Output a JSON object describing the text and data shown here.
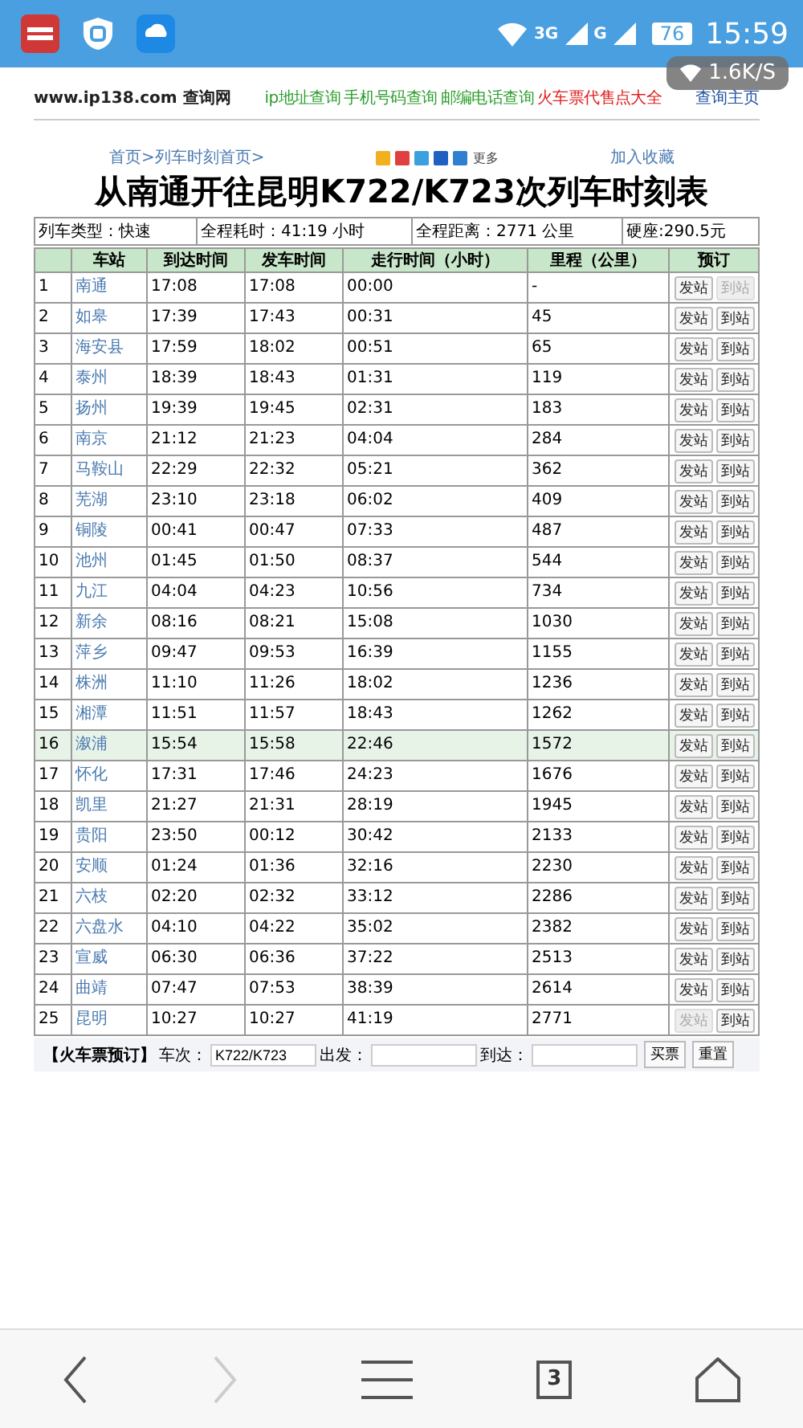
{
  "status_bar": {
    "network_3g": "3G",
    "network_g": "G",
    "battery": "76",
    "time": "15:59",
    "speed": "1.6K/S"
  },
  "header": {
    "site": "www.ip138.com 查询网",
    "links": [
      {
        "label": "ip地址查询",
        "color": "#2e9e2e"
      },
      {
        "label": "手机号码查询",
        "color": "#2e9e2e"
      },
      {
        "label": "邮编电话查询",
        "color": "#2e9e2e"
      },
      {
        "label": "火车票代售点大全",
        "color": "#e02020"
      }
    ],
    "home": "查询主页"
  },
  "breadcrumb": "首页>列车时刻首页>",
  "share_more": "更多",
  "bookmark": "加入收藏",
  "title": "从南通开往昆明K722/K723次列车时刻表",
  "info": [
    "列车类型：快速",
    "全程耗时：41:19 小时",
    "全程距离：2771 公里",
    "硬座:290.5元"
  ],
  "table": {
    "columns": [
      "",
      "车站",
      "到达时间",
      "发车时间",
      "走行时间（小时）",
      "里程（公里）",
      "预订"
    ],
    "rows": [
      {
        "no": "1",
        "station": "南通",
        "arrive": "17:08",
        "depart": "17:08",
        "elapsed": "00:00",
        "km": "-",
        "selected": false,
        "buttons": [
          {
            "label": "发站",
            "disabled": false
          },
          {
            "label": "到站",
            "disabled": true
          }
        ]
      },
      {
        "no": "2",
        "station": "如皋",
        "arrive": "17:39",
        "depart": "17:43",
        "elapsed": "00:31",
        "km": "45",
        "selected": false,
        "buttons": [
          {
            "label": "发站",
            "disabled": false
          },
          {
            "label": "到站",
            "disabled": false
          }
        ]
      },
      {
        "no": "3",
        "station": "海安县",
        "arrive": "17:59",
        "depart": "18:02",
        "elapsed": "00:51",
        "km": "65",
        "selected": false,
        "buttons": [
          {
            "label": "发站",
            "disabled": false
          },
          {
            "label": "到站",
            "disabled": false
          }
        ]
      },
      {
        "no": "4",
        "station": "泰州",
        "arrive": "18:39",
        "depart": "18:43",
        "elapsed": "01:31",
        "km": "119",
        "selected": false,
        "buttons": [
          {
            "label": "发站",
            "disabled": false
          },
          {
            "label": "到站",
            "disabled": false
          }
        ]
      },
      {
        "no": "5",
        "station": "扬州",
        "arrive": "19:39",
        "depart": "19:45",
        "elapsed": "02:31",
        "km": "183",
        "selected": false,
        "buttons": [
          {
            "label": "发站",
            "disabled": false
          },
          {
            "label": "到站",
            "disabled": false
          }
        ]
      },
      {
        "no": "6",
        "station": "南京",
        "arrive": "21:12",
        "depart": "21:23",
        "elapsed": "04:04",
        "km": "284",
        "selected": false,
        "buttons": [
          {
            "label": "发站",
            "disabled": false
          },
          {
            "label": "到站",
            "disabled": false
          }
        ]
      },
      {
        "no": "7",
        "station": "马鞍山",
        "arrive": "22:29",
        "depart": "22:32",
        "elapsed": "05:21",
        "km": "362",
        "selected": false,
        "buttons": [
          {
            "label": "发站",
            "disabled": false
          },
          {
            "label": "到站",
            "disabled": false
          }
        ]
      },
      {
        "no": "8",
        "station": "芜湖",
        "arrive": "23:10",
        "depart": "23:18",
        "elapsed": "06:02",
        "km": "409",
        "selected": false,
        "buttons": [
          {
            "label": "发站",
            "disabled": false
          },
          {
            "label": "到站",
            "disabled": false
          }
        ]
      },
      {
        "no": "9",
        "station": "铜陵",
        "arrive": "00:41",
        "depart": "00:47",
        "elapsed": "07:33",
        "km": "487",
        "selected": false,
        "buttons": [
          {
            "label": "发站",
            "disabled": false
          },
          {
            "label": "到站",
            "disabled": false
          }
        ]
      },
      {
        "no": "10",
        "station": "池州",
        "arrive": "01:45",
        "depart": "01:50",
        "elapsed": "08:37",
        "km": "544",
        "selected": false,
        "buttons": [
          {
            "label": "发站",
            "disabled": false
          },
          {
            "label": "到站",
            "disabled": false
          }
        ]
      },
      {
        "no": "11",
        "station": "九江",
        "arrive": "04:04",
        "depart": "04:23",
        "elapsed": "10:56",
        "km": "734",
        "selected": false,
        "buttons": [
          {
            "label": "发站",
            "disabled": false
          },
          {
            "label": "到站",
            "disabled": false
          }
        ]
      },
      {
        "no": "12",
        "station": "新余",
        "arrive": "08:16",
        "depart": "08:21",
        "elapsed": "15:08",
        "km": "1030",
        "selected": false,
        "buttons": [
          {
            "label": "发站",
            "disabled": false
          },
          {
            "label": "到站",
            "disabled": false
          }
        ]
      },
      {
        "no": "13",
        "station": "萍乡",
        "arrive": "09:47",
        "depart": "09:53",
        "elapsed": "16:39",
        "km": "1155",
        "selected": false,
        "buttons": [
          {
            "label": "发站",
            "disabled": false
          },
          {
            "label": "到站",
            "disabled": false
          }
        ]
      },
      {
        "no": "14",
        "station": "株洲",
        "arrive": "11:10",
        "depart": "11:26",
        "elapsed": "18:02",
        "km": "1236",
        "selected": false,
        "buttons": [
          {
            "label": "发站",
            "disabled": false
          },
          {
            "label": "到站",
            "disabled": false
          }
        ]
      },
      {
        "no": "15",
        "station": "湘潭",
        "arrive": "11:51",
        "depart": "11:57",
        "elapsed": "18:43",
        "km": "1262",
        "selected": false,
        "buttons": [
          {
            "label": "发站",
            "disabled": false
          },
          {
            "label": "到站",
            "disabled": false
          }
        ]
      },
      {
        "no": "16",
        "station": "溆浦",
        "arrive": "15:54",
        "depart": "15:58",
        "elapsed": "22:46",
        "km": "1572",
        "selected": true,
        "buttons": [
          {
            "label": "发站",
            "disabled": false
          },
          {
            "label": "到站",
            "disabled": false
          }
        ]
      },
      {
        "no": "17",
        "station": "怀化",
        "arrive": "17:31",
        "depart": "17:46",
        "elapsed": "24:23",
        "km": "1676",
        "selected": false,
        "buttons": [
          {
            "label": "发站",
            "disabled": false
          },
          {
            "label": "到站",
            "disabled": false
          }
        ]
      },
      {
        "no": "18",
        "station": "凯里",
        "arrive": "21:27",
        "depart": "21:31",
        "elapsed": "28:19",
        "km": "1945",
        "selected": false,
        "buttons": [
          {
            "label": "发站",
            "disabled": false
          },
          {
            "label": "到站",
            "disabled": false
          }
        ]
      },
      {
        "no": "19",
        "station": "贵阳",
        "arrive": "23:50",
        "depart": "00:12",
        "elapsed": "30:42",
        "km": "2133",
        "selected": false,
        "buttons": [
          {
            "label": "发站",
            "disabled": false
          },
          {
            "label": "到站",
            "disabled": false
          }
        ]
      },
      {
        "no": "20",
        "station": "安顺",
        "arrive": "01:24",
        "depart": "01:36",
        "elapsed": "32:16",
        "km": "2230",
        "selected": false,
        "buttons": [
          {
            "label": "发站",
            "disabled": false
          },
          {
            "label": "到站",
            "disabled": false
          }
        ]
      },
      {
        "no": "21",
        "station": "六枝",
        "arrive": "02:20",
        "depart": "02:32",
        "elapsed": "33:12",
        "km": "2286",
        "selected": false,
        "buttons": [
          {
            "label": "发站",
            "disabled": false
          },
          {
            "label": "到站",
            "disabled": false
          }
        ]
      },
      {
        "no": "22",
        "station": "六盘水",
        "arrive": "04:10",
        "depart": "04:22",
        "elapsed": "35:02",
        "km": "2382",
        "selected": false,
        "buttons": [
          {
            "label": "发站",
            "disabled": false
          },
          {
            "label": "到站",
            "disabled": false
          }
        ]
      },
      {
        "no": "23",
        "station": "宣威",
        "arrive": "06:30",
        "depart": "06:36",
        "elapsed": "37:22",
        "km": "2513",
        "selected": false,
        "buttons": [
          {
            "label": "发站",
            "disabled": false
          },
          {
            "label": "到站",
            "disabled": false
          }
        ]
      },
      {
        "no": "24",
        "station": "曲靖",
        "arrive": "07:47",
        "depart": "07:53",
        "elapsed": "38:39",
        "km": "2614",
        "selected": false,
        "buttons": [
          {
            "label": "发站",
            "disabled": false
          },
          {
            "label": "到站",
            "disabled": false
          }
        ]
      },
      {
        "no": "25",
        "station": "昆明",
        "arrive": "10:27",
        "depart": "10:27",
        "elapsed": "41:19",
        "km": "2771",
        "selected": false,
        "buttons": [
          {
            "label": "发站",
            "disabled": true
          },
          {
            "label": "到站",
            "disabled": false
          }
        ]
      }
    ]
  },
  "booking_form": {
    "title": "【火车票预订】",
    "fields": [
      {
        "label": "车次：",
        "value": "K722/K723"
      },
      {
        "label": "出发："
      },
      {
        "label": "到达："
      }
    ],
    "buttons": [
      "买票",
      "重置"
    ]
  },
  "nav_bar": {
    "forward_disabled": true,
    "tab_count": "3"
  }
}
